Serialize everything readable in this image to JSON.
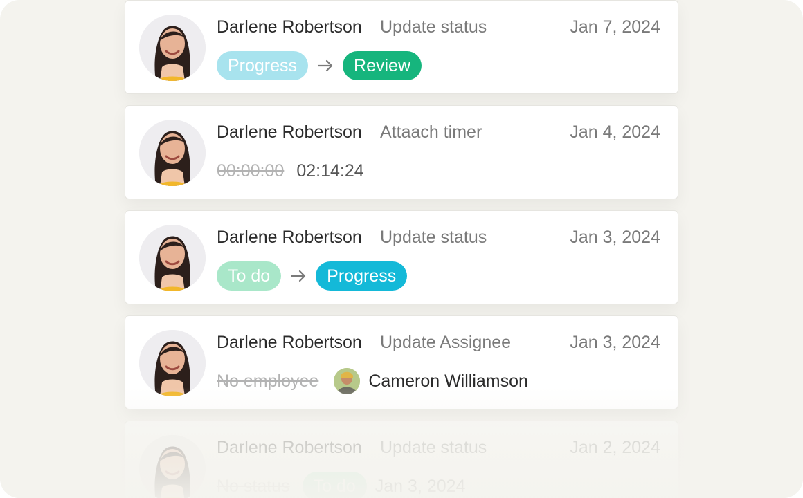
{
  "activity": [
    {
      "user": "Darlene Robertson",
      "action": "Update status",
      "date": "Jan 7, 2024",
      "from": "Progress",
      "to": "Review"
    },
    {
      "user": "Darlene Robertson",
      "action": "Attaach timer",
      "date": "Jan 4, 2024",
      "old_time": "00:00:00",
      "new_time": "02:14:24"
    },
    {
      "user": "Darlene Robertson",
      "action": "Update status",
      "date": "Jan 3, 2024",
      "from": "To do",
      "to": "Progress"
    },
    {
      "user": "Darlene Robertson",
      "action": "Update Assignee",
      "date": "Jan 3, 2024",
      "old_assignee": "No employee",
      "new_assignee": "Cameron Williamson"
    },
    {
      "user": "Darlene Robertson",
      "action": "Update status",
      "date": "Jan 2, 2024",
      "old_status": "No status",
      "new_status": "To do",
      "due_date": "Jan 3, 2024"
    }
  ],
  "icons": {
    "arrow": "arrow-right-icon"
  },
  "colors": {
    "background": "#f4f3ee",
    "progress_light": "#a8e3ee",
    "review": "#16b57d",
    "todo_light": "#a9e7c9",
    "progress": "#14b9d8"
  }
}
